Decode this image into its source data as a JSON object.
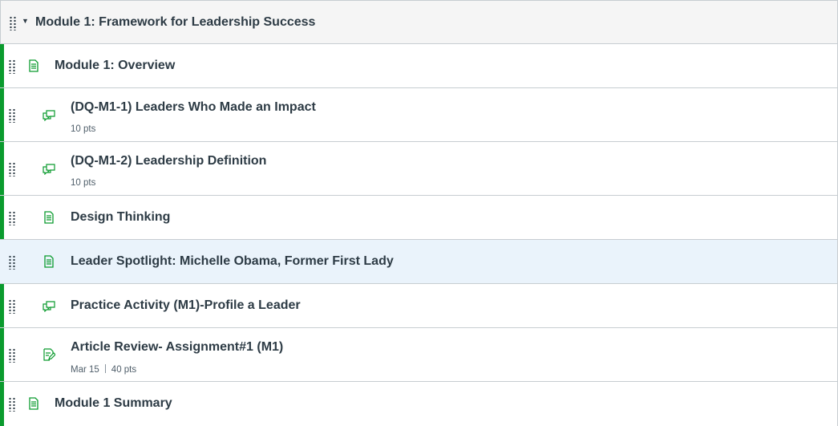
{
  "module": {
    "title": "Module 1: Framework for Leadership Success",
    "accent_color": "#0b9b2e",
    "items": [
      {
        "icon": "page-icon",
        "title": "Module 1: Overview",
        "indent": 0
      },
      {
        "icon": "discussion-icon",
        "title": "(DQ-M1-1) Leaders Who Made an Impact",
        "points": "10 pts"
      },
      {
        "icon": "discussion-icon",
        "title": "(DQ-M1-2) Leadership Definition",
        "points": "10 pts"
      },
      {
        "icon": "page-icon",
        "title": "Design Thinking"
      },
      {
        "icon": "page-icon",
        "title": "Leader Spotlight: Michelle Obama, Former First Lady",
        "highlighted": true
      },
      {
        "icon": "discussion-icon",
        "title": "Practice Activity (M1)-Profile a Leader"
      },
      {
        "icon": "assignment-icon",
        "title": "Article Review- Assignment#1 (M1)",
        "due": "Mar 15",
        "points": "40 pts"
      },
      {
        "icon": "page-icon",
        "title": "Module 1 Summary",
        "indent": 0
      }
    ]
  }
}
